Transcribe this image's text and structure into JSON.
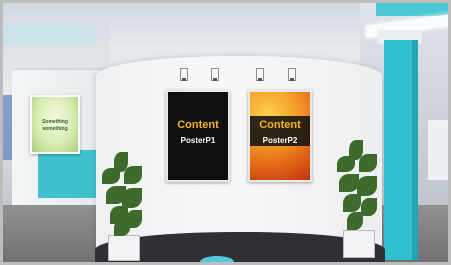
{
  "scene": {
    "type": "virtual exhibition booth",
    "colors": {
      "accent_teal": "#2fbfd0",
      "wall": "#f2f3f4",
      "floor": "#6d6f71"
    }
  },
  "posters": [
    {
      "title": "Content",
      "subtitle": "PosterP1"
    },
    {
      "title": "Content",
      "subtitle": "PosterP2"
    }
  ],
  "left_poster": {
    "line1": "Something",
    "line2": "something"
  }
}
